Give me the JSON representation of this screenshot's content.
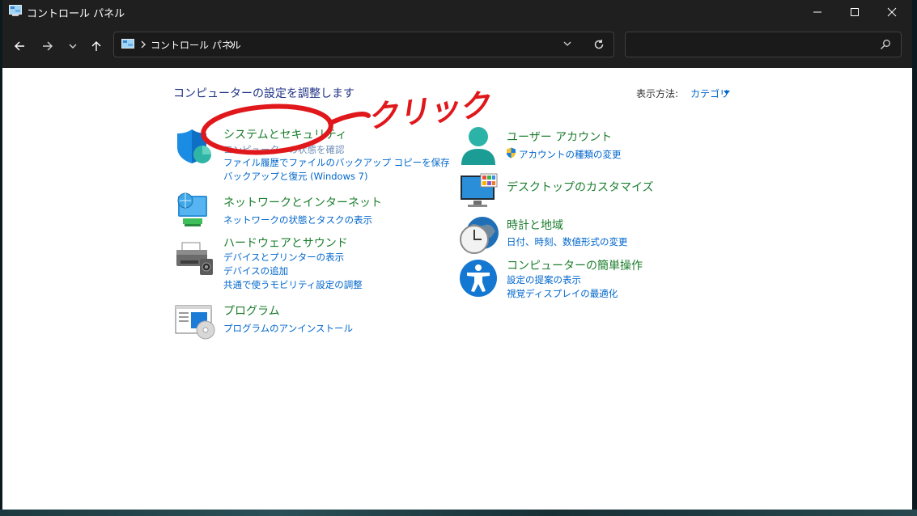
{
  "window": {
    "title": "コントロール パネル"
  },
  "address": {
    "breadcrumb": "コントロール パネル",
    "search_placeholder": ""
  },
  "page": {
    "title": "コンピューターの設定を調整します",
    "view_by_label": "表示方法:",
    "view_by_value": "カテゴリ"
  },
  "categories": {
    "system": {
      "title": "システムとセキュリティ",
      "links": [
        "コンピューターの状態を確認",
        "ファイル履歴でファイルのバックアップ コピーを保存",
        "バックアップと復元 (Windows 7)"
      ]
    },
    "network": {
      "title": "ネットワークとインターネット",
      "links": [
        "ネットワークの状態とタスクの表示"
      ]
    },
    "hardware": {
      "title": "ハードウェアとサウンド",
      "links": [
        "デバイスとプリンターの表示",
        "デバイスの追加",
        "共通で使うモビリティ設定の調整"
      ]
    },
    "programs": {
      "title": "プログラム",
      "links": [
        "プログラムのアンインストール"
      ]
    },
    "user": {
      "title": "ユーザー アカウント",
      "links": [
        "アカウントの種類の変更"
      ]
    },
    "desktop": {
      "title": "デスクトップのカスタマイズ",
      "links": []
    },
    "clock": {
      "title": "時計と地域",
      "links": [
        "日付、時刻、数値形式の変更"
      ]
    },
    "access": {
      "title": "コンピューターの簡単操作",
      "links": [
        "設定の提案の表示",
        "視覚ディスプレイの最適化"
      ]
    }
  },
  "annotation": {
    "text": "クリック",
    "color": "#e0181b"
  },
  "colors": {
    "title_green": "#1b7d2c",
    "link_blue": "#0066cc",
    "heading_blue": "#1e3287",
    "chrome_dark": "#1f1f1f"
  }
}
